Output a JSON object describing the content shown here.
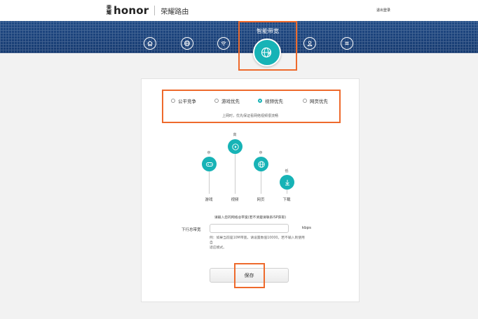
{
  "header": {
    "logo_text": "honor",
    "logo_mark": "荣耀",
    "title": "荣耀路由",
    "logout": "退出登录"
  },
  "nav": {
    "items": [
      {
        "name": "home",
        "icon": "home-icon"
      },
      {
        "name": "internet",
        "icon": "globe-icon"
      },
      {
        "name": "wifi",
        "icon": "wifi-icon"
      },
      {
        "name": "smart-bandwidth",
        "icon": "globe-bolt-icon",
        "label": "智能带宽",
        "active": true
      },
      {
        "name": "devices",
        "icon": "user-icon"
      },
      {
        "name": "more",
        "icon": "menu-icon"
      }
    ]
  },
  "qos": {
    "options": [
      {
        "label": "公平竞争",
        "selected": false
      },
      {
        "label": "游戏优先",
        "selected": false
      },
      {
        "label": "视频优先",
        "selected": true
      },
      {
        "label": "网页优先",
        "selected": false
      }
    ],
    "hint": "上网时，优先保证看网络视频很流畅"
  },
  "modes": [
    {
      "name": "游戏",
      "level": "中",
      "icon": "gamepad-icon"
    },
    {
      "name": "视频",
      "level": "高",
      "icon": "play-icon"
    },
    {
      "name": "网页",
      "level": "中",
      "icon": "globe-icon"
    },
    {
      "name": "下载",
      "level": "低",
      "icon": "download-icon"
    }
  ],
  "bandwidth": {
    "note": "请输入您的网络总带宽(若不清楚请联系ISP获取)",
    "label": "下行总带宽",
    "value": "",
    "unit": "kbps",
    "example_line1": "例：如果当前是10M带宽，请设置数值10000。若不输入则使用自",
    "example_line2": "适应模式。"
  },
  "actions": {
    "save": "保存"
  },
  "colors": {
    "accent": "#17b3b6",
    "nav_bg": "#1f4a85",
    "highlight": "#ee6a2c"
  }
}
